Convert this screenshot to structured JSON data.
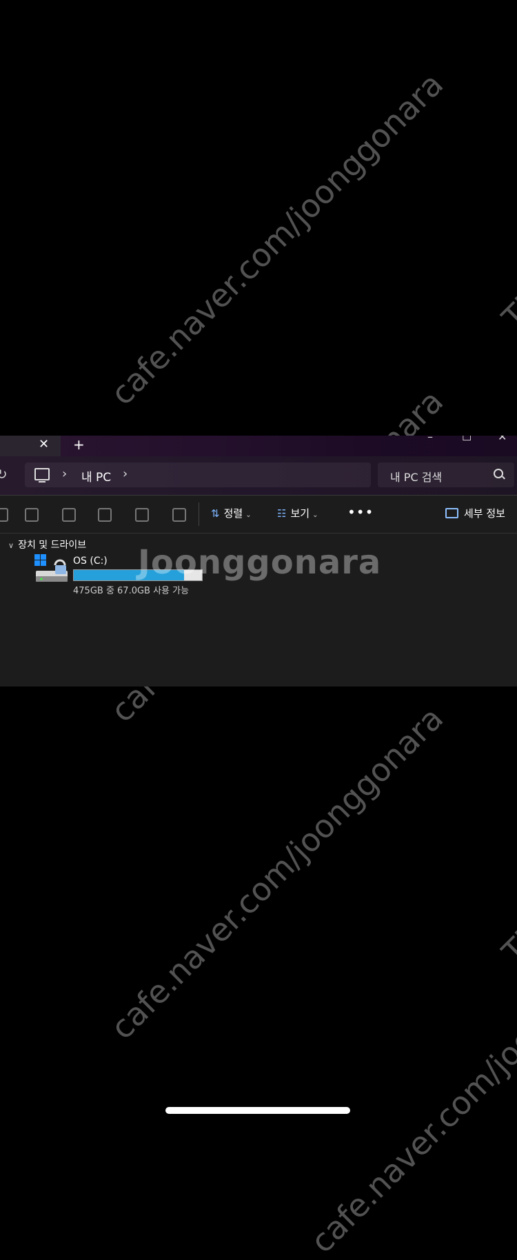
{
  "tab": {
    "close": "✕",
    "new_tab": "+"
  },
  "window_controls": {
    "minimize": "–",
    "maximize": "☐",
    "close": "✕"
  },
  "navbar": {
    "refresh_icon": "refresh-icon",
    "breadcrumb_label": "내 PC",
    "separator": "›",
    "search_placeholder": "내 PC 검색"
  },
  "toolbar": {
    "sort_label": "정렬",
    "view_label": "보기",
    "more_label": "•••",
    "details_label": "세부 정보",
    "sort_icon": "⇅",
    "view_icon": "☷"
  },
  "group": {
    "label": "장치 및 드라이브"
  },
  "drive": {
    "name": "OS (C:)",
    "free_text": "475GB 중 67.0GB 사용 가능",
    "used_fraction": 0.859,
    "bar_color": "#26a0da"
  },
  "watermark": {
    "url_text": "cafe.naver.com/joonggonara",
    "logo_text": "Joonggonara",
    "edge_text": "Th"
  }
}
